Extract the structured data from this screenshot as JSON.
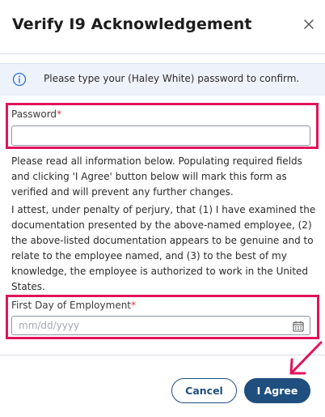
{
  "dialog": {
    "title": "Verify I9 Acknowledgement",
    "close_icon": "close-icon"
  },
  "info_banner": {
    "icon": "info-icon",
    "text": "Please type your (Haley White) password to confirm."
  },
  "password_field": {
    "label": "Password",
    "required_marker": "*",
    "value": "",
    "placeholder": ""
  },
  "notice_text": "Please read all information below. Populating required fields and clicking 'I Agree' button below will mark this form as verified and will prevent any further changes.",
  "attestation_text": "I attest, under penalty of perjury, that (1) I have examined the documentation presented by the above-named employee, (2) the above-listed documentation appears to be genuine and to relate to the employee named, and (3) to the best of my knowledge, the employee is authorized to work in the United States.",
  "first_day_field": {
    "label": "First Day of Employment",
    "required_marker": "*",
    "value": "",
    "placeholder": "mm/dd/yyyy",
    "icon": "calendar-icon"
  },
  "footer": {
    "cancel_label": "Cancel",
    "agree_label": "I Agree"
  },
  "colors": {
    "highlight": "#e2135b",
    "primary": "#1f4f7e",
    "info_background": "#eef2fa",
    "required": "#d63342"
  }
}
